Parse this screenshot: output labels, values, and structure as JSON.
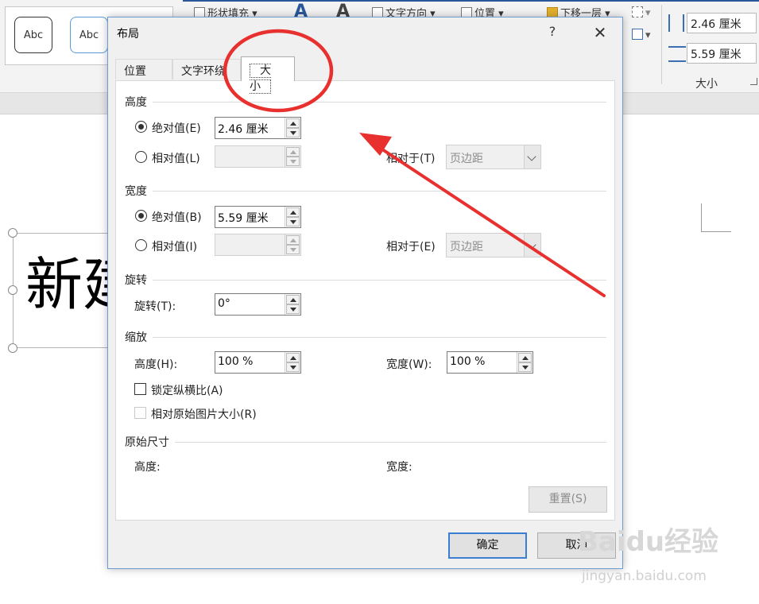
{
  "ribbon": {
    "style_samples": [
      "Abc",
      "Abc"
    ],
    "shape_fill": "形状填充",
    "text_direction": "文字方向",
    "position": "位置",
    "send_backward": "下移一层",
    "bigA_1": "A",
    "bigA_2": "A",
    "height_value": "2.46 厘米",
    "width_value": "5.59 厘米",
    "size_group_label": "大小"
  },
  "document": {
    "text": "新建文本"
  },
  "dialog": {
    "title": "布局",
    "help": "?",
    "close": "✕",
    "tabs": [
      "位置",
      "文字环绕",
      "大小"
    ],
    "height": {
      "title": "高度",
      "absolute_label": "绝对值(E)",
      "absolute_value": "2.46 厘米",
      "relative_label": "相对值(L)",
      "relative_value": "",
      "relative_to_label": "相对于(T)",
      "relative_to_value": "页边距"
    },
    "width": {
      "title": "宽度",
      "absolute_label": "绝对值(B)",
      "absolute_value": "5.59 厘米",
      "relative_label": "相对值(I)",
      "relative_value": "",
      "relative_to_label": "相对于(E)",
      "relative_to_value": "页边距"
    },
    "rotation": {
      "title": "旋转",
      "label": "旋转(T):",
      "value": "0°"
    },
    "scale": {
      "title": "缩放",
      "height_label": "高度(H):",
      "height_value": "100 %",
      "width_label": "宽度(W):",
      "width_value": "100 %",
      "lock_aspect": "锁定纵横比(A)",
      "relative_original": "相对原始图片大小(R)"
    },
    "original": {
      "title": "原始尺寸",
      "height_label": "高度:",
      "width_label": "宽度:",
      "reset": "重置(S)"
    },
    "ok": "确定",
    "cancel": "取消"
  },
  "watermark": {
    "main": "Baidu经验",
    "sub": "jingyan.baidu.com"
  },
  "colors": {
    "annotation_red": "#e8312f",
    "accent_blue": "#2b579a"
  }
}
